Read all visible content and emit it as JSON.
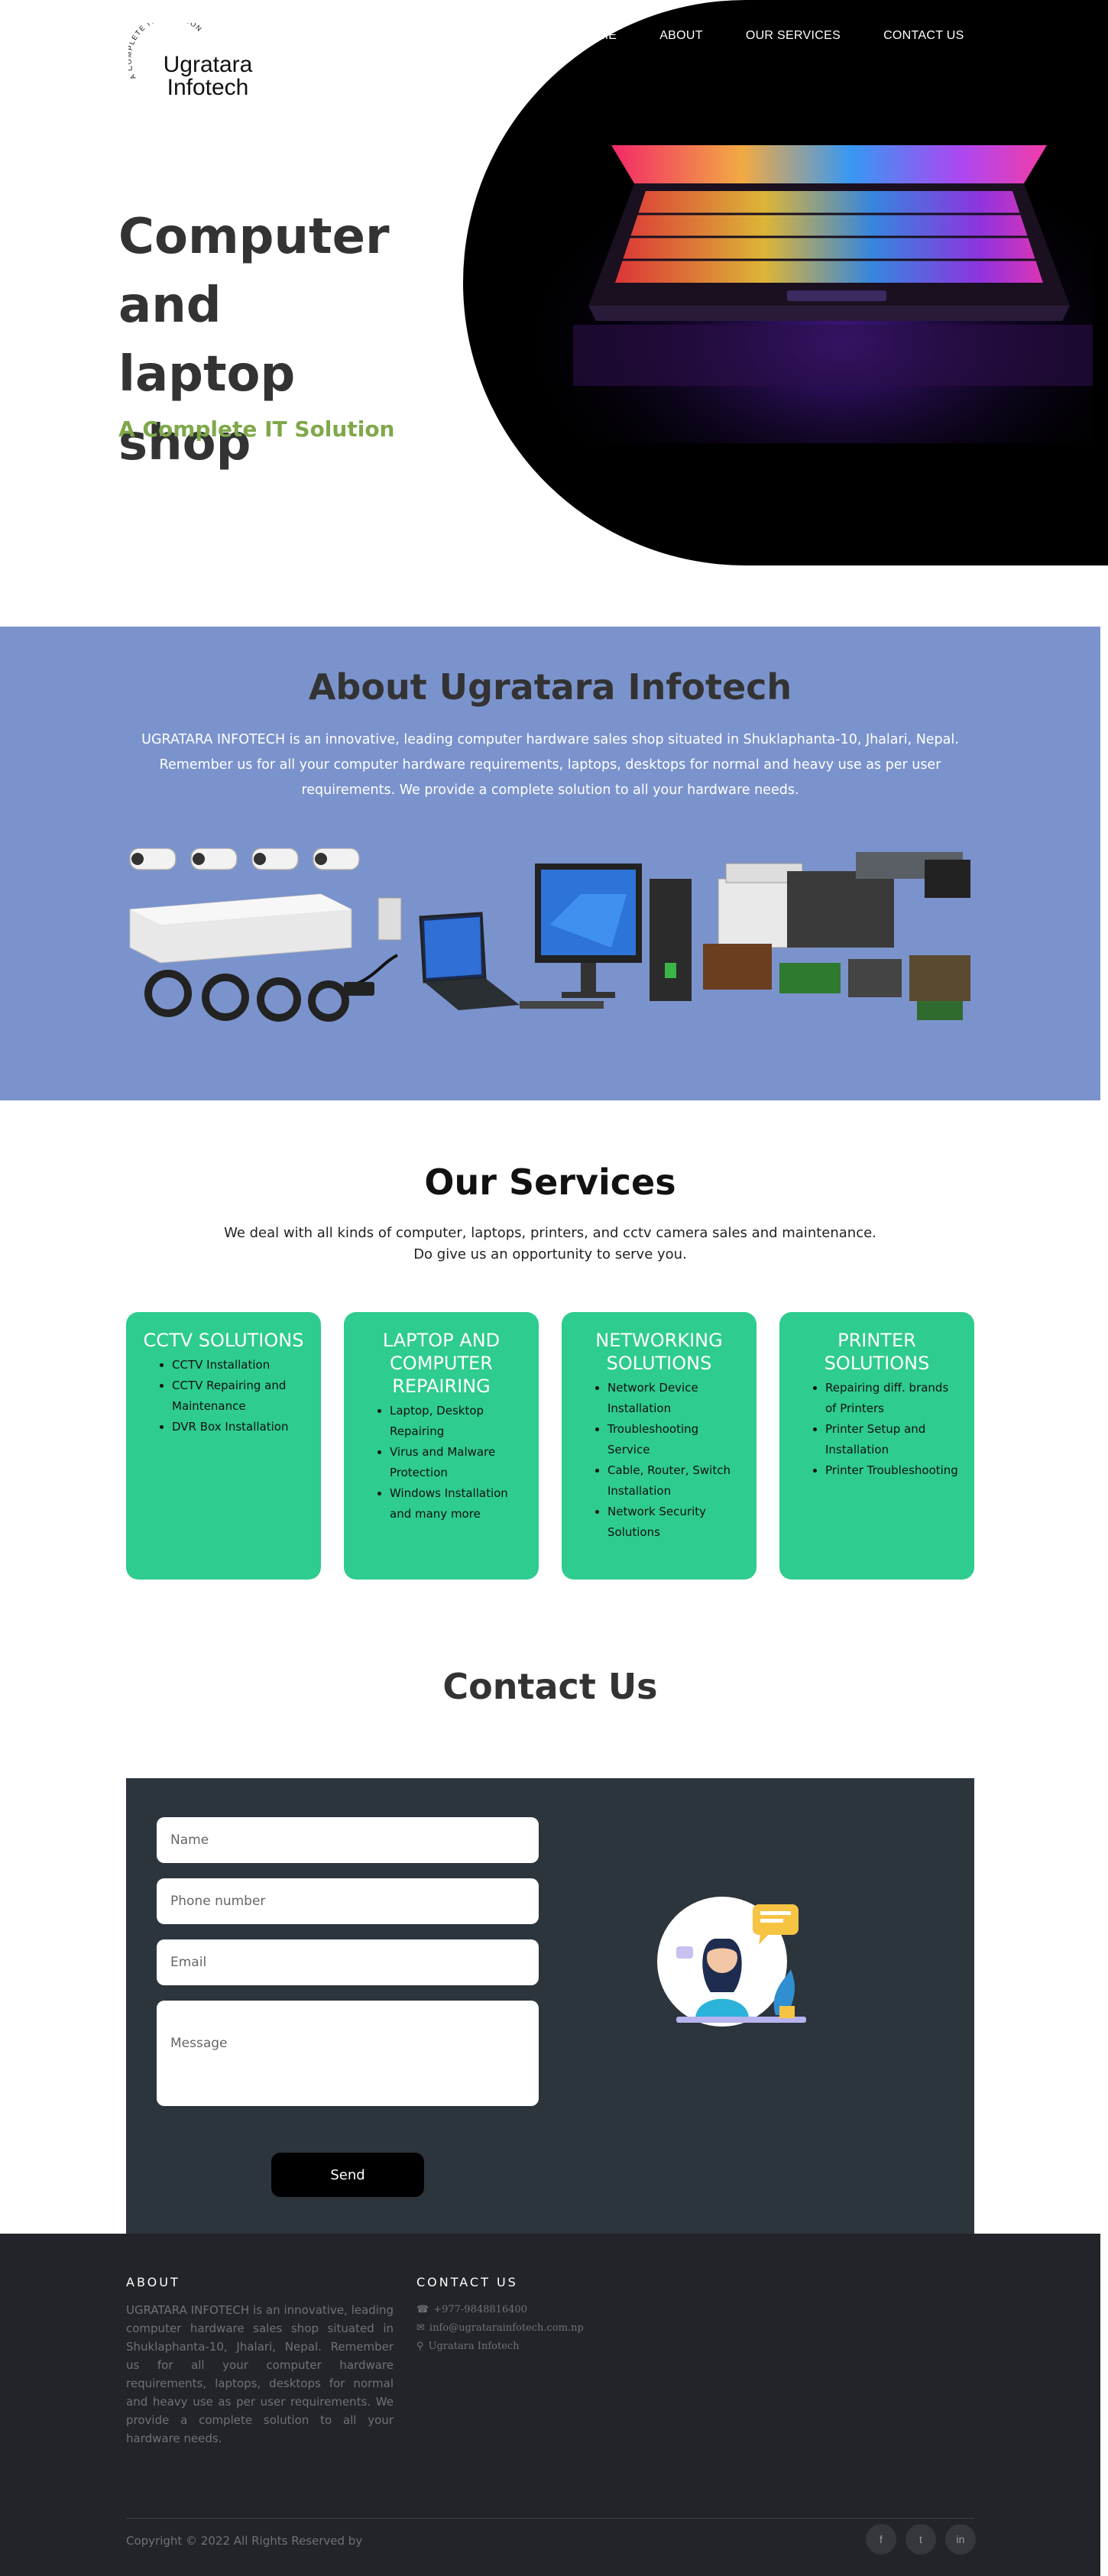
{
  "header": {
    "logo_arc_text": "A COMPLETE IT SOLUTION",
    "logo_line1": "Ugratara",
    "logo_line2": "Infotech",
    "nav": [
      "HOME",
      "ABOUT",
      "OUR SERVICES",
      "CONTACT US"
    ]
  },
  "hero": {
    "title_line1": "Computer",
    "title_line2": "and",
    "title_line3": "laptop shop",
    "subtitle": "A Complete IT Solution"
  },
  "about": {
    "title": "About Ugratara Infotech",
    "text": "UGRATARA INFOTECH is an innovative, leading computer hardware sales shop situated in Shuklaphanta-10, Jhalari, Nepal. Remember us for all your computer hardware requirements, laptops, desktops for normal and heavy use as per user requirements. We provide a complete solution to all your hardware needs."
  },
  "services": {
    "title": "Our Services",
    "text_line1": "We deal with all kinds of computer, laptops, printers, and cctv camera sales and maintenance.",
    "text_line2": "Do give us an opportunity to serve you.",
    "cards": [
      {
        "title": "CCTV SOLUTIONS",
        "items": [
          "CCTV Installation",
          "CCTV Repairing and Maintenance",
          "DVR Box Installation"
        ]
      },
      {
        "title": "LAPTOP AND COMPUTER REPAIRING",
        "items": [
          "Laptop, Desktop Repairing",
          "Virus and Malware Protection",
          "Windows Installation and many more"
        ]
      },
      {
        "title": "NETWORKING SOLUTIONS",
        "items": [
          "Network Device Installation",
          "Troubleshooting Service",
          "Cable, Router, Switch Installation",
          "Network Security Solutions"
        ]
      },
      {
        "title": "PRINTER SOLUTIONS",
        "items": [
          "Repairing diff. brands of Printers",
          "Printer Setup and Installation",
          "Printer Troubleshooting"
        ]
      }
    ]
  },
  "contact": {
    "title": "Contact Us",
    "name_placeholder": "Name",
    "phone_placeholder": "Phone number",
    "email_placeholder": "Email",
    "message_placeholder": "Message",
    "send_label": "Send"
  },
  "footer": {
    "about_heading": "ABOUT",
    "about_text": "UGRATARA INFOTECH is an innovative, leading computer hardware sales shop situated in Shuklaphanta-10, Jhalari, Nepal. Remember us for all your computer hardware requirements, laptops, desktops for normal and heavy use as per user requirements. We provide a complete solution to all your hardware needs.",
    "contact_heading": "CONTACT US",
    "phone": "+977-9848816400",
    "email": "info@ugratarainfotech.com.np",
    "location": "Ugratara Infotech",
    "copyright": "Copyright © 2022 All Rights Reserved by",
    "socials": [
      "f",
      "t",
      "in"
    ]
  },
  "colors": {
    "about_bg": "#7b93cc",
    "card_green": "#2ecc8e",
    "subtitle_green": "#7fa84a",
    "contact_bg": "#2c343c",
    "footer_bg": "#232429"
  }
}
